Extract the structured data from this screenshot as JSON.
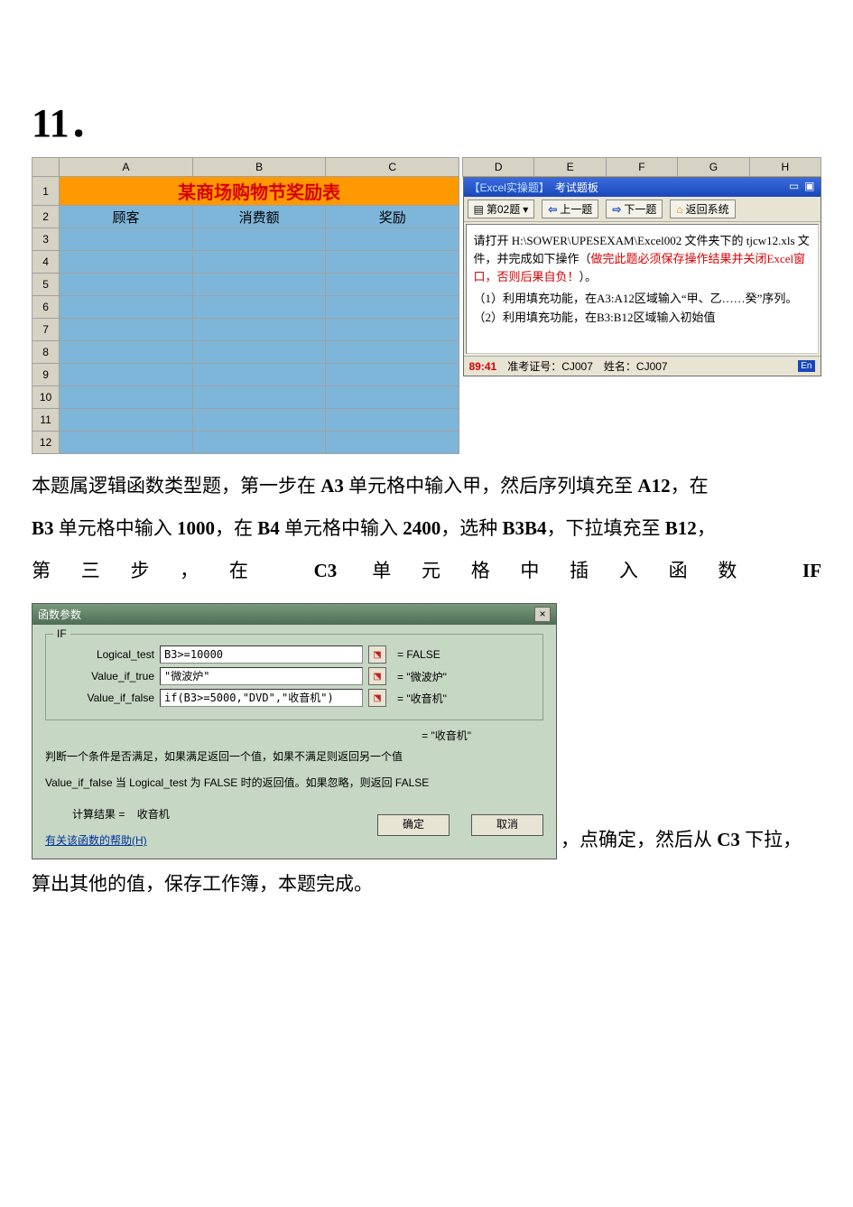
{
  "heading": "11．",
  "sheet": {
    "cols": [
      "",
      "A",
      "B",
      "C",
      "D",
      "E",
      "F",
      "G",
      "H"
    ],
    "row_nums": [
      "1",
      "2",
      "3",
      "4",
      "5",
      "6",
      "7",
      "8",
      "9",
      "10",
      "11",
      "12"
    ],
    "title": "某商场购物节奖励表",
    "headers": [
      "顾客",
      "消费额",
      "奖励"
    ]
  },
  "exam": {
    "title1": "【Excel实操题】",
    "title2": "考试题板",
    "dropdown": "第02题",
    "prev": "上一题",
    "next": "下一题",
    "back": "返回系统",
    "body_pre": "请打开 H:\\SOWER\\UPESEXAM\\Excel002 文件夹下的 tjcw12.xls 文件，并完成如下操作（",
    "body_red": "做完此题必须保存操作结果并关闭Excel窗口，否则后果自负！",
    "body_post": "）。",
    "step1": "（1）利用填充功能，在A3:A12区域输入“甲、乙……癸”序列。",
    "step2": "（2）利用填充功能，在B3:B12区域输入初始值",
    "timer": "89:41",
    "id_label": "准考证号：",
    "id_value": "CJ007",
    "name_label": "姓名：",
    "name_value": "CJ007",
    "lang": "En"
  },
  "para1_a": "本题属逻辑函数类型题，第一步在 ",
  "para1_b": "A3",
  "para1_c": " 单元格中输入甲，然后序列填充至 ",
  "para1_d": "A12",
  "para1_e": "，在",
  "para2_a": "B3",
  "para2_b": " 单元格中输入 ",
  "para2_c": "1000",
  "para2_d": "，在 ",
  "para2_e": "B4",
  "para2_f": " 单元格中输入 ",
  "para2_g": "2400",
  "para2_h": "，选种 ",
  "para2_i": "B3B4",
  "para2_j": "，下拉填充至 ",
  "para2_k": "B12",
  "para2_l": "，",
  "para3_a": "第三步，在",
  "para3_b": "C3",
  "para3_c": "单元格中插入函数",
  "para3_d": "IF",
  "dialog": {
    "title": "函数参数",
    "legend": "IF",
    "lbl_test": "Logical_test",
    "val_test": "B3>=10000",
    "eq_test": "= FALSE",
    "lbl_true": "Value_if_true",
    "val_true": "\"微波炉\"",
    "eq_true": "= \"微波炉\"",
    "lbl_false": "Value_if_false",
    "val_false": "if(B3>=5000,\"DVD\",\"收音机\")",
    "eq_false": "= \"收音机\"",
    "eq_result_top": "= \"收音机\"",
    "desc1": "判断一个条件是否满足，如果满足返回一个值，如果不满足则返回另一个值",
    "desc2": "Value_if_false   当 Logical_test 为 FALSE 时的返回值。如果忽略，则返回 FALSE",
    "result_label": "计算结果 =",
    "result_value": "收音机",
    "help": "有关该函数的帮助(H)",
    "ok": "确定",
    "cancel": "取消"
  },
  "after_dialog": "，点确定，然后从 ",
  "after_dialog_b": "C3",
  "after_dialog_c": " 下拉，",
  "para_final": "算出其他的值，保存工作簿，本题完成。"
}
